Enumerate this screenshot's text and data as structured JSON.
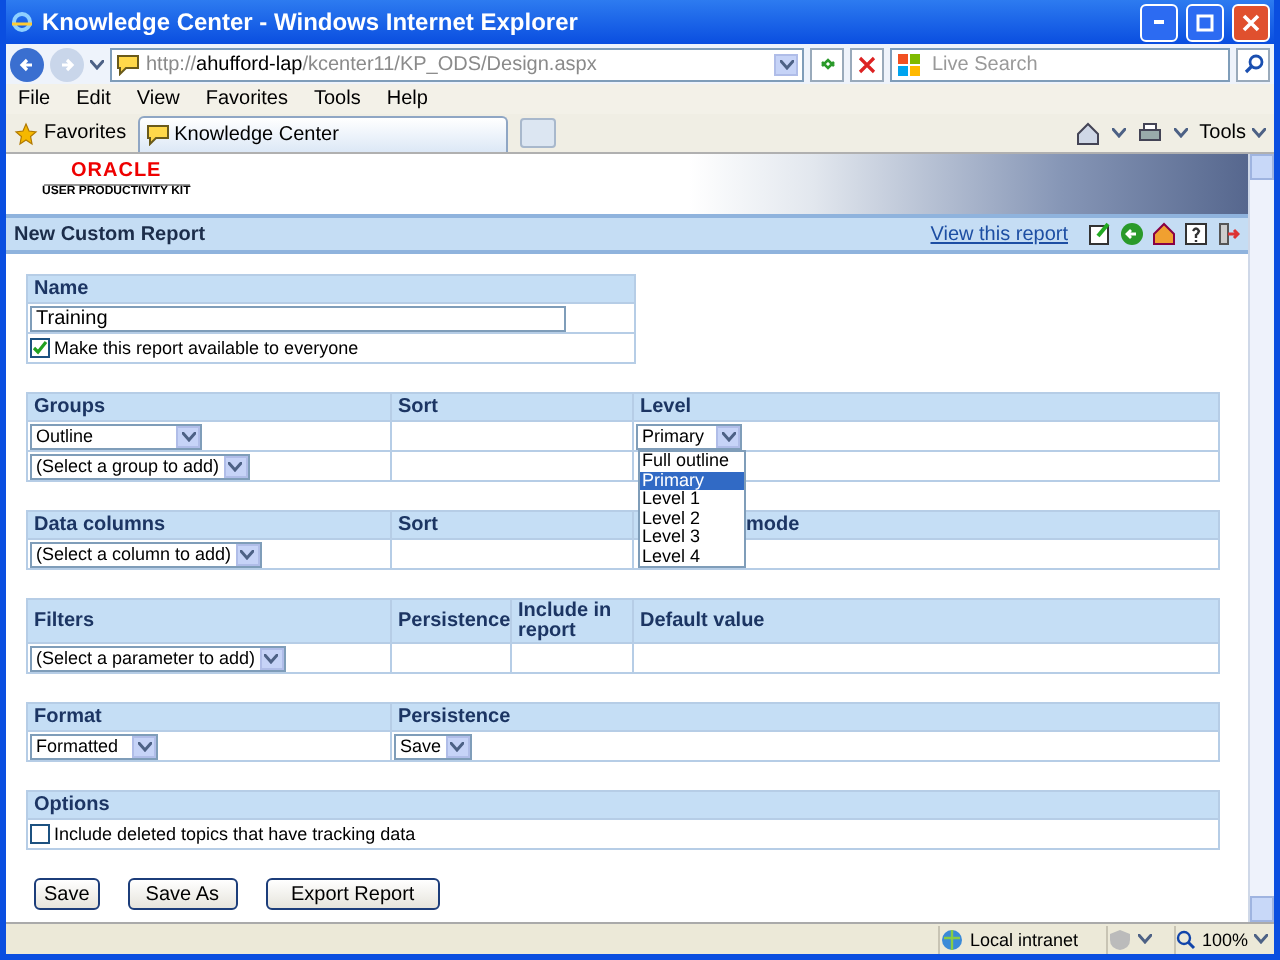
{
  "window": {
    "title": "Knowledge Center - Windows Internet Explorer"
  },
  "address_bar": {
    "url_prefix": "http://",
    "url_host": "ahufford-lap",
    "url_path": "/kcenter11/KP_ODS/Design.aspx",
    "search_placeholder": "Live Search"
  },
  "menu": [
    "File",
    "Edit",
    "View",
    "Favorites",
    "Tools",
    "Help"
  ],
  "favorites_bar": {
    "favorites": "Favorites",
    "tab": "Knowledge Center",
    "tools": "Tools"
  },
  "logo": {
    "name": "ORACLE",
    "subtitle": "USER PRODUCTIVITY KIT"
  },
  "page": {
    "title": "New Custom Report",
    "link": "View this report"
  },
  "name_section": {
    "heading": "Name",
    "value": "Training",
    "share": {
      "label": "Make this report available to everyone",
      "checked": true
    }
  },
  "groups": {
    "columns": [
      "Groups",
      "Sort",
      "Level"
    ],
    "rows": [
      {
        "group": "Outline",
        "level": "Primary"
      },
      {
        "group": "(Select a group to add)"
      }
    ],
    "level_options": [
      {
        "label": "Full outline",
        "selected": false
      },
      {
        "label": "Primary",
        "selected": true
      },
      {
        "label": "Level 1",
        "selected": false
      },
      {
        "label": "Level 2",
        "selected": false
      },
      {
        "label": "Level 3",
        "selected": false
      },
      {
        "label": "Level 4",
        "selected": false
      }
    ]
  },
  "data_columns": {
    "columns": [
      "Data columns",
      "Sort",
      "mode"
    ],
    "select": "(Select a column to add)"
  },
  "filters": {
    "columns": [
      "Filters",
      "Persistence",
      "Include in report",
      "Default value"
    ],
    "select": "(Select a parameter to add)"
  },
  "format": {
    "columns": [
      "Format",
      "Persistence"
    ],
    "format": "Formatted",
    "persistence": "Save"
  },
  "options": {
    "heading": "Options",
    "items": [
      {
        "label": "Include deleted topics that have tracking data",
        "checked": false
      }
    ]
  },
  "buttons": [
    "Save",
    "Save As",
    "Export Report"
  ],
  "status_bar": {
    "zone": "Local intranet",
    "zoom": "100%"
  }
}
